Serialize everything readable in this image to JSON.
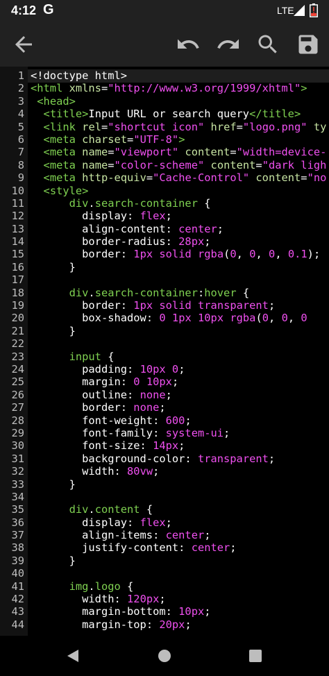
{
  "status_bar": {
    "time": "4:12",
    "google_icon": "G",
    "network": "LTE",
    "signal_icon": "signal-icon",
    "battery_icon": "battery-alert-icon"
  },
  "toolbar": {
    "back_icon": "arrow-left-icon",
    "undo_icon": "undo-icon",
    "redo_icon": "redo-icon",
    "search_icon": "search-icon",
    "save_icon": "save-icon"
  },
  "colors": {
    "tag": "#7fd151",
    "attribute": "#c7e4a3",
    "string": "#f050f0",
    "selector": "#7fd151",
    "property": "#ffffff",
    "value": "#f050f0"
  },
  "editor": {
    "lines": [
      {
        "n": "1",
        "tokens": [
          [
            "plain",
            "<!doctype html>"
          ]
        ]
      },
      {
        "n": "2",
        "tokens": [
          [
            "tag",
            "<html"
          ],
          [
            "plain",
            " "
          ],
          [
            "attr",
            "xmlns"
          ],
          [
            "plain",
            "="
          ],
          [
            "str",
            "\"http://www.w3.org/1999/xhtml\""
          ],
          [
            "tag",
            ">"
          ]
        ]
      },
      {
        "n": "3",
        "tokens": [
          [
            "plain",
            " "
          ],
          [
            "tag",
            "<head>"
          ]
        ]
      },
      {
        "n": "4",
        "tokens": [
          [
            "plain",
            "  "
          ],
          [
            "tag",
            "<title>"
          ],
          [
            "plain",
            "Input URL or search query"
          ],
          [
            "tag",
            "</title>"
          ]
        ]
      },
      {
        "n": "5",
        "tokens": [
          [
            "plain",
            "  "
          ],
          [
            "tag",
            "<link"
          ],
          [
            "plain",
            " "
          ],
          [
            "attr",
            "rel"
          ],
          [
            "plain",
            "="
          ],
          [
            "str",
            "\"shortcut icon\""
          ],
          [
            "plain",
            " "
          ],
          [
            "attr",
            "href"
          ],
          [
            "plain",
            "="
          ],
          [
            "str",
            "\"logo.png\""
          ],
          [
            "plain",
            " "
          ],
          [
            "attr",
            "ty"
          ]
        ]
      },
      {
        "n": "6",
        "tokens": [
          [
            "plain",
            "  "
          ],
          [
            "tag",
            "<meta"
          ],
          [
            "plain",
            " "
          ],
          [
            "attr",
            "charset"
          ],
          [
            "plain",
            "="
          ],
          [
            "str",
            "\"UTF-8\""
          ],
          [
            "tag",
            ">"
          ]
        ]
      },
      {
        "n": "7",
        "tokens": [
          [
            "plain",
            "  "
          ],
          [
            "tag",
            "<meta"
          ],
          [
            "plain",
            " "
          ],
          [
            "attr",
            "name"
          ],
          [
            "plain",
            "="
          ],
          [
            "str",
            "\"viewport\""
          ],
          [
            "plain",
            " "
          ],
          [
            "attr",
            "content"
          ],
          [
            "plain",
            "="
          ],
          [
            "str",
            "\"width=device-"
          ]
        ]
      },
      {
        "n": "8",
        "tokens": [
          [
            "plain",
            "  "
          ],
          [
            "tag",
            "<meta"
          ],
          [
            "plain",
            " "
          ],
          [
            "attr",
            "name"
          ],
          [
            "plain",
            "="
          ],
          [
            "str",
            "\"color-scheme\""
          ],
          [
            "plain",
            " "
          ],
          [
            "attr",
            "content"
          ],
          [
            "plain",
            "="
          ],
          [
            "str",
            "\"dark ligh"
          ]
        ]
      },
      {
        "n": "9",
        "tokens": [
          [
            "plain",
            "  "
          ],
          [
            "tag",
            "<meta"
          ],
          [
            "plain",
            " "
          ],
          [
            "attr",
            "http-equiv"
          ],
          [
            "plain",
            "="
          ],
          [
            "str",
            "\"Cache-Control\""
          ],
          [
            "plain",
            " "
          ],
          [
            "attr",
            "content"
          ],
          [
            "plain",
            "="
          ],
          [
            "str",
            "\"no"
          ]
        ]
      },
      {
        "n": "10",
        "tokens": [
          [
            "plain",
            "  "
          ],
          [
            "tag",
            "<style>"
          ]
        ]
      },
      {
        "n": "11",
        "tokens": [
          [
            "plain",
            "      "
          ],
          [
            "sel",
            "div"
          ],
          [
            "plain",
            "."
          ],
          [
            "sel",
            "search-container"
          ],
          [
            "plain",
            " {"
          ]
        ]
      },
      {
        "n": "12",
        "tokens": [
          [
            "plain",
            "        "
          ],
          [
            "prop",
            "display"
          ],
          [
            "plain",
            ": "
          ],
          [
            "val",
            "flex"
          ],
          [
            "plain",
            ";"
          ]
        ]
      },
      {
        "n": "13",
        "tokens": [
          [
            "plain",
            "        "
          ],
          [
            "prop",
            "align-content"
          ],
          [
            "plain",
            ": "
          ],
          [
            "val",
            "center"
          ],
          [
            "plain",
            ";"
          ]
        ]
      },
      {
        "n": "14",
        "tokens": [
          [
            "plain",
            "        "
          ],
          [
            "prop",
            "border-radius"
          ],
          [
            "plain",
            ": "
          ],
          [
            "val",
            "28px"
          ],
          [
            "plain",
            ";"
          ]
        ]
      },
      {
        "n": "15",
        "tokens": [
          [
            "plain",
            "        "
          ],
          [
            "prop",
            "border"
          ],
          [
            "plain",
            ": "
          ],
          [
            "val",
            "1px"
          ],
          [
            "plain",
            " "
          ],
          [
            "val",
            "solid"
          ],
          [
            "plain",
            " "
          ],
          [
            "val",
            "rgba"
          ],
          [
            "plain",
            "("
          ],
          [
            "val",
            "0"
          ],
          [
            "plain",
            ", "
          ],
          [
            "val",
            "0"
          ],
          [
            "plain",
            ", "
          ],
          [
            "val",
            "0"
          ],
          [
            "plain",
            ", "
          ],
          [
            "val",
            "0.1"
          ],
          [
            "plain",
            ");"
          ]
        ]
      },
      {
        "n": "16",
        "tokens": [
          [
            "plain",
            "      }"
          ]
        ]
      },
      {
        "n": "17",
        "tokens": [
          [
            "plain",
            ""
          ]
        ]
      },
      {
        "n": "18",
        "tokens": [
          [
            "plain",
            "      "
          ],
          [
            "sel",
            "div"
          ],
          [
            "plain",
            "."
          ],
          [
            "sel",
            "search-container"
          ],
          [
            "plain",
            ":"
          ],
          [
            "sel",
            "hover"
          ],
          [
            "plain",
            " {"
          ]
        ]
      },
      {
        "n": "19",
        "tokens": [
          [
            "plain",
            "        "
          ],
          [
            "prop",
            "border"
          ],
          [
            "plain",
            ": "
          ],
          [
            "val",
            "1px"
          ],
          [
            "plain",
            " "
          ],
          [
            "val",
            "solid"
          ],
          [
            "plain",
            " "
          ],
          [
            "val",
            "transparent"
          ],
          [
            "plain",
            ";"
          ]
        ]
      },
      {
        "n": "20",
        "tokens": [
          [
            "plain",
            "        "
          ],
          [
            "prop",
            "box-shadow"
          ],
          [
            "plain",
            ": "
          ],
          [
            "val",
            "0"
          ],
          [
            "plain",
            " "
          ],
          [
            "val",
            "1px"
          ],
          [
            "plain",
            " "
          ],
          [
            "val",
            "10px"
          ],
          [
            "plain",
            " "
          ],
          [
            "val",
            "rgba"
          ],
          [
            "plain",
            "("
          ],
          [
            "val",
            "0"
          ],
          [
            "plain",
            ", "
          ],
          [
            "val",
            "0"
          ],
          [
            "plain",
            ", "
          ],
          [
            "val",
            "0"
          ]
        ]
      },
      {
        "n": "21",
        "tokens": [
          [
            "plain",
            "      }"
          ]
        ]
      },
      {
        "n": "22",
        "tokens": [
          [
            "plain",
            ""
          ]
        ]
      },
      {
        "n": "23",
        "tokens": [
          [
            "plain",
            "      "
          ],
          [
            "sel",
            "input"
          ],
          [
            "plain",
            " {"
          ]
        ]
      },
      {
        "n": "24",
        "tokens": [
          [
            "plain",
            "        "
          ],
          [
            "prop",
            "padding"
          ],
          [
            "plain",
            ": "
          ],
          [
            "val",
            "10px"
          ],
          [
            "plain",
            " "
          ],
          [
            "val",
            "0"
          ],
          [
            "plain",
            ";"
          ]
        ]
      },
      {
        "n": "25",
        "tokens": [
          [
            "plain",
            "        "
          ],
          [
            "prop",
            "margin"
          ],
          [
            "plain",
            ": "
          ],
          [
            "val",
            "0"
          ],
          [
            "plain",
            " "
          ],
          [
            "val",
            "10px"
          ],
          [
            "plain",
            ";"
          ]
        ]
      },
      {
        "n": "26",
        "tokens": [
          [
            "plain",
            "        "
          ],
          [
            "prop",
            "outline"
          ],
          [
            "plain",
            ": "
          ],
          [
            "val",
            "none"
          ],
          [
            "plain",
            ";"
          ]
        ]
      },
      {
        "n": "27",
        "tokens": [
          [
            "plain",
            "        "
          ],
          [
            "prop",
            "border"
          ],
          [
            "plain",
            ": "
          ],
          [
            "val",
            "none"
          ],
          [
            "plain",
            ";"
          ]
        ]
      },
      {
        "n": "28",
        "tokens": [
          [
            "plain",
            "        "
          ],
          [
            "prop",
            "font-weight"
          ],
          [
            "plain",
            ": "
          ],
          [
            "val",
            "600"
          ],
          [
            "plain",
            ";"
          ]
        ]
      },
      {
        "n": "29",
        "tokens": [
          [
            "plain",
            "        "
          ],
          [
            "prop",
            "font-family"
          ],
          [
            "plain",
            ": "
          ],
          [
            "val",
            "system-ui"
          ],
          [
            "plain",
            ";"
          ]
        ]
      },
      {
        "n": "30",
        "tokens": [
          [
            "plain",
            "        "
          ],
          [
            "prop",
            "font-size"
          ],
          [
            "plain",
            ": "
          ],
          [
            "val",
            "14px"
          ],
          [
            "plain",
            ";"
          ]
        ]
      },
      {
        "n": "31",
        "tokens": [
          [
            "plain",
            "        "
          ],
          [
            "prop",
            "background-color"
          ],
          [
            "plain",
            ": "
          ],
          [
            "val",
            "transparent"
          ],
          [
            "plain",
            ";"
          ]
        ]
      },
      {
        "n": "32",
        "tokens": [
          [
            "plain",
            "        "
          ],
          [
            "prop",
            "width"
          ],
          [
            "plain",
            ": "
          ],
          [
            "val",
            "80vw"
          ],
          [
            "plain",
            ";"
          ]
        ]
      },
      {
        "n": "33",
        "tokens": [
          [
            "plain",
            "      }"
          ]
        ]
      },
      {
        "n": "34",
        "tokens": [
          [
            "plain",
            ""
          ]
        ]
      },
      {
        "n": "35",
        "tokens": [
          [
            "plain",
            "      "
          ],
          [
            "sel",
            "div"
          ],
          [
            "plain",
            "."
          ],
          [
            "sel",
            "content"
          ],
          [
            "plain",
            " {"
          ]
        ]
      },
      {
        "n": "36",
        "tokens": [
          [
            "plain",
            "        "
          ],
          [
            "prop",
            "display"
          ],
          [
            "plain",
            ": "
          ],
          [
            "val",
            "flex"
          ],
          [
            "plain",
            ";"
          ]
        ]
      },
      {
        "n": "37",
        "tokens": [
          [
            "plain",
            "        "
          ],
          [
            "prop",
            "align-items"
          ],
          [
            "plain",
            ": "
          ],
          [
            "val",
            "center"
          ],
          [
            "plain",
            ";"
          ]
        ]
      },
      {
        "n": "38",
        "tokens": [
          [
            "plain",
            "        "
          ],
          [
            "prop",
            "justify-content"
          ],
          [
            "plain",
            ": "
          ],
          [
            "val",
            "center"
          ],
          [
            "plain",
            ";"
          ]
        ]
      },
      {
        "n": "39",
        "tokens": [
          [
            "plain",
            "      }"
          ]
        ]
      },
      {
        "n": "40",
        "tokens": [
          [
            "plain",
            ""
          ]
        ]
      },
      {
        "n": "41",
        "tokens": [
          [
            "plain",
            "      "
          ],
          [
            "sel",
            "img"
          ],
          [
            "plain",
            "."
          ],
          [
            "sel",
            "logo"
          ],
          [
            "plain",
            " {"
          ]
        ]
      },
      {
        "n": "42",
        "tokens": [
          [
            "plain",
            "        "
          ],
          [
            "prop",
            "width"
          ],
          [
            "plain",
            ": "
          ],
          [
            "val",
            "120px"
          ],
          [
            "plain",
            ";"
          ]
        ]
      },
      {
        "n": "43",
        "tokens": [
          [
            "plain",
            "        "
          ],
          [
            "prop",
            "margin-bottom"
          ],
          [
            "plain",
            ": "
          ],
          [
            "val",
            "10px"
          ],
          [
            "plain",
            ";"
          ]
        ]
      },
      {
        "n": "44",
        "tokens": [
          [
            "plain",
            "        "
          ],
          [
            "prop",
            "margin-top"
          ],
          [
            "plain",
            ": "
          ],
          [
            "val",
            "20px"
          ],
          [
            "plain",
            ";"
          ]
        ]
      }
    ]
  },
  "nav_bar": {
    "back_icon": "nav-back-icon",
    "home_icon": "nav-home-icon",
    "recents_icon": "nav-recents-icon"
  }
}
